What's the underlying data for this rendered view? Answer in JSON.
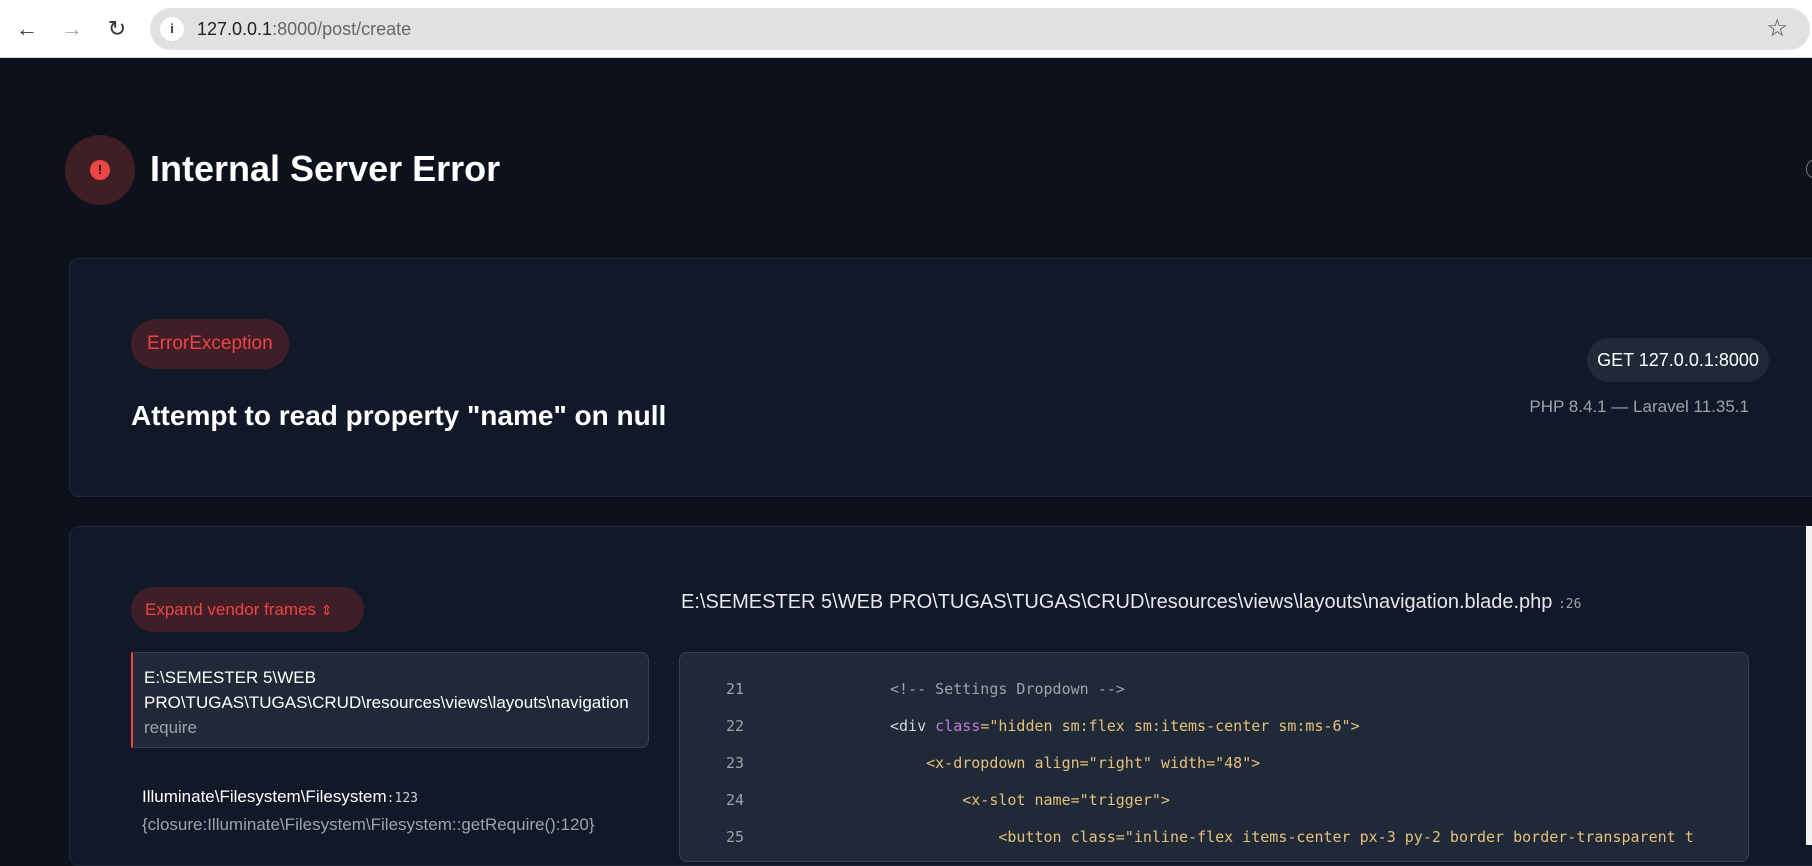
{
  "browser": {
    "url_host": "127.0.0.1",
    "url_rest": ":8000/post/create"
  },
  "header": {
    "title": "Internal Server Error"
  },
  "exception": {
    "type": "ErrorException",
    "message": "Attempt to read property \"name\" on null",
    "request": "GET 127.0.0.1:8000",
    "versions": "PHP 8.4.1 — Laravel 11.35.1"
  },
  "trace": {
    "expand_label": "Expand vendor frames",
    "frames": [
      {
        "line1": "E:\\SEMESTER 5\\WEB",
        "line2": "PRO\\TUGAS\\TUGAS\\CRUD\\resources\\views\\layouts\\navigation",
        "func": "require"
      },
      {
        "class": "Illuminate\\Filesystem\\Filesystem",
        "line": ":123",
        "func": "{closure:Illuminate\\Filesystem\\Filesystem::getRequire():120}"
      }
    ]
  },
  "code": {
    "file": "E:\\SEMESTER 5\\WEB PRO\\TUGAS\\TUGAS\\CRUD\\resources\\views\\layouts\\navigation.blade.php",
    "line": ":26",
    "lines": [
      {
        "n": "21",
        "a": "<!-- Settings Dropdown -->"
      },
      {
        "n": "22",
        "a": "<div ",
        "b": "class",
        "c": "=\"hidden sm:flex sm:items-center sm:ms-6\">"
      },
      {
        "n": "23",
        "a": "    <x-dropdown align=\"right\" width=\"48\">"
      },
      {
        "n": "24",
        "a": "        <x-slot name=\"trigger\">"
      },
      {
        "n": "25",
        "a": "            <button class=\"inline-flex items-center px-3 py-2 border border-transparent t"
      }
    ]
  }
}
